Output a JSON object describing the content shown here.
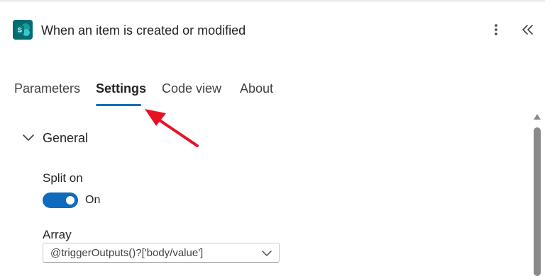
{
  "header": {
    "title": "When an item is created or modified",
    "app_icon": "sharepoint-icon",
    "more_icon": "more-vertical-icon",
    "collapse_icon": "double-chevron-left-icon",
    "brand_color": "#036c70"
  },
  "tabs": [
    {
      "label": "Parameters",
      "active": false
    },
    {
      "label": "Settings",
      "active": true
    },
    {
      "label": "Code view",
      "active": false
    },
    {
      "label": "About",
      "active": false
    }
  ],
  "annotation": {
    "icon": "red-arrow-icon",
    "color": "#e81123"
  },
  "section": {
    "title": "General",
    "expanded": true,
    "chevron_icon": "chevron-down-icon"
  },
  "split_on": {
    "label": "Split on",
    "toggle_state": "On",
    "enabled": true,
    "accent_color": "#0f6cbd"
  },
  "array": {
    "label": "Array",
    "value": "@triggerOutputs()?['body/value']",
    "chevron_icon": "chevron-down-icon"
  }
}
